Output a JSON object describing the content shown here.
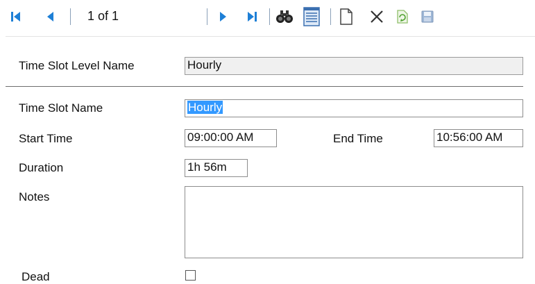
{
  "toolbar": {
    "record_counter": "1 of 1",
    "buttons": [
      {
        "name": "first-record",
        "icon": "first-record-icon"
      },
      {
        "name": "previous-record",
        "icon": "previous-record-icon"
      },
      {
        "name": "next-record",
        "icon": "next-record-icon"
      },
      {
        "name": "last-record",
        "icon": "last-record-icon"
      },
      {
        "name": "find",
        "icon": "binoculars-icon"
      },
      {
        "name": "list-view",
        "icon": "list-icon"
      },
      {
        "name": "new-record",
        "icon": "new-document-icon"
      },
      {
        "name": "delete-record",
        "icon": "delete-x-icon"
      },
      {
        "name": "refresh",
        "icon": "refresh-icon"
      },
      {
        "name": "save",
        "icon": "save-disk-icon"
      }
    ],
    "accent": "#1e7fd6"
  },
  "form": {
    "level_name": {
      "label": "Time Slot Level Name",
      "value": "Hourly"
    },
    "slot_name": {
      "label": "Time Slot Name",
      "value": "Hourly"
    },
    "start_time": {
      "label": "Start Time",
      "value": "09:00:00 AM"
    },
    "end_time": {
      "label": "End Time",
      "value": "10:56:00 AM"
    },
    "duration": {
      "label": "Duration",
      "value": "1h 56m"
    },
    "notes": {
      "label": "Notes",
      "value": ""
    },
    "dead": {
      "label": "Dead",
      "checked": false
    }
  }
}
